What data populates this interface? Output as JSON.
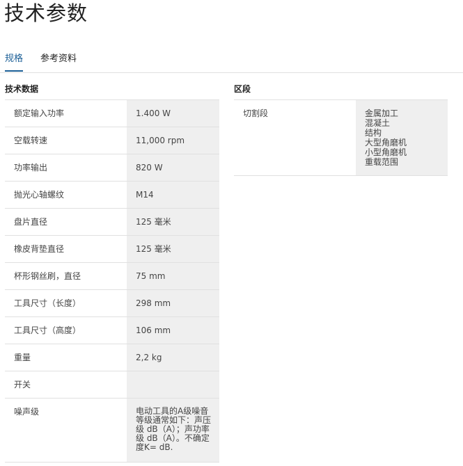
{
  "page": {
    "title": "技术参数"
  },
  "tabs": [
    {
      "label": "规格",
      "active": true
    },
    {
      "label": "参考资料",
      "active": false
    }
  ],
  "tech_section": {
    "heading": "技术数据",
    "rows": [
      {
        "label": "额定输入功率",
        "value": "1.400 W"
      },
      {
        "label": "空载转速",
        "value": "11,000 rpm"
      },
      {
        "label": "功率输出",
        "value": "820 W"
      },
      {
        "label": "抛光心轴螺纹",
        "value": "M14"
      },
      {
        "label": "盘片直径",
        "value": "125 毫米"
      },
      {
        "label": "橡皮背垫直径",
        "value": "125 毫米"
      },
      {
        "label": "杯形钢丝刷，直径",
        "value": "75 mm"
      },
      {
        "label": "工具尺寸（长度）",
        "value": "298 mm"
      },
      {
        "label": "工具尺寸（高度）",
        "value": "106 mm"
      },
      {
        "label": "重量",
        "value": "2,2 kg"
      },
      {
        "label": "开关",
        "value": ""
      },
      {
        "label": "噪声级",
        "value": "电动工具的A级噪音等级通常如下：声压级 dB（A）；声功率级 dB（A）。不确定度K= dB."
      }
    ]
  },
  "segment_section": {
    "heading": "区段",
    "rows": [
      {
        "label": "切割段",
        "values": [
          "金属加工",
          "混凝土",
          "结构",
          "大型角磨机",
          "小型角磨机",
          "重载范围"
        ]
      }
    ]
  },
  "colors": {
    "accent": "#1a5e96",
    "value_bg": "#efefef",
    "divider": "#e0e0e0"
  }
}
